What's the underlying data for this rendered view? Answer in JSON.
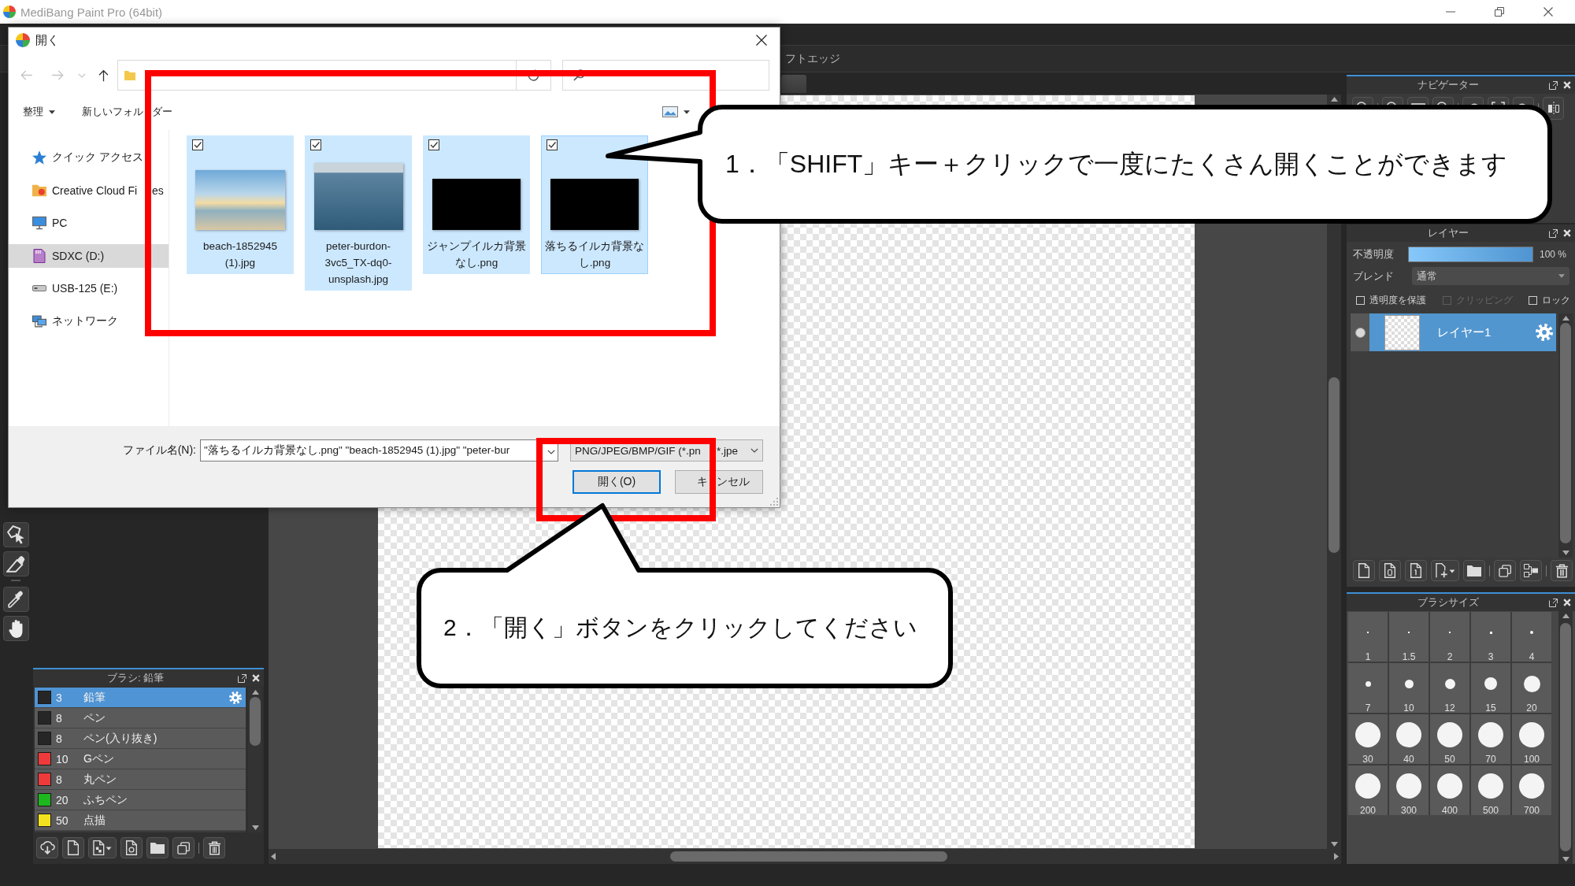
{
  "window": {
    "title": "MediBang Paint Pro (64bit)"
  },
  "tool_options": {
    "label": "フトエッジ"
  },
  "brush_panel": {
    "title": "ブラシ: 鉛筆",
    "brushes": [
      {
        "size": "3",
        "name": "鉛筆",
        "color": "#262626",
        "selected": true
      },
      {
        "size": "8",
        "name": "ペン",
        "color": "#262626",
        "selected": false
      },
      {
        "size": "8",
        "name": "ペン(入り抜き)",
        "color": "#262626",
        "selected": false
      },
      {
        "size": "10",
        "name": "Gペン",
        "color": "#ee3a3a",
        "selected": false
      },
      {
        "size": "8",
        "name": "丸ペン",
        "color": "#ee3a3a",
        "selected": false
      },
      {
        "size": "20",
        "name": "ふちペン",
        "color": "#1db81d",
        "selected": false
      },
      {
        "size": "50",
        "name": "点描",
        "color": "#f2e21e",
        "selected": false
      }
    ]
  },
  "navigator_panel": {
    "title": "ナビゲーター"
  },
  "layer_panel": {
    "title": "レイヤー",
    "opacity": {
      "label": "不透明度",
      "level": 1,
      "reading": "100 %"
    },
    "blend": {
      "label": "ブレンド",
      "value": "通常"
    },
    "options": [
      {
        "label": "透明度を保護",
        "checked": false,
        "disabled": false
      },
      {
        "label": "クリッピング",
        "checked": false,
        "disabled": true
      },
      {
        "label": "ロック",
        "checked": false,
        "disabled": false
      }
    ],
    "layers": [
      {
        "name": "レイヤー1",
        "selected": true,
        "visible": true
      }
    ]
  },
  "brush_size_panel": {
    "title": "ブラシサイズ",
    "sizes": [
      "1",
      "1.5",
      "2",
      "3",
      "4",
      "7",
      "10",
      "12",
      "15",
      "20",
      "30",
      "40",
      "50",
      "70",
      "100",
      "200",
      "300",
      "400",
      "500",
      "700"
    ]
  },
  "dialog": {
    "title": "開く",
    "nav": [
      {
        "kind": "back",
        "disabled": true
      },
      {
        "kind": "forward",
        "disabled": true
      },
      {
        "kind": "recent",
        "disabled": true
      },
      {
        "kind": "up",
        "disabled": false
      }
    ],
    "commands": [
      {
        "label": "整理",
        "kind": "menu"
      },
      {
        "label": "新しいフォル",
        "label_rest": "ダー",
        "kind": "plain"
      }
    ],
    "sidebar": [
      {
        "label": "クイック アクセス",
        "kind": "quick-access",
        "selected": false
      },
      {
        "label": "Creative Cloud Fi",
        "label_rest": "es",
        "kind": "cloud-folder",
        "selected": false
      },
      {
        "label": "PC",
        "kind": "pc",
        "selected": false
      },
      {
        "label": "SDXC (D:)",
        "kind": "sd-card",
        "selected": true
      },
      {
        "label": "USB-125 (E:)",
        "kind": "usb-drive",
        "selected": false
      },
      {
        "label": "ネットワーク",
        "kind": "network",
        "selected": false
      }
    ],
    "files": [
      {
        "name": "beach-1852945 (1).jpg",
        "checked": true,
        "selected": true,
        "focused": false
      },
      {
        "name": "peter-burdon-3vc5_TX-dq0-unsplash.jpg",
        "checked": true,
        "selected": true,
        "focused": false
      },
      {
        "name": "ジャンプイルカ背景なし.png",
        "checked": true,
        "selected": true,
        "focused": false
      },
      {
        "name": "落ちるイルカ背景なし.png",
        "checked": true,
        "selected": true,
        "focused": true
      }
    ],
    "filename": {
      "label": "ファイル名(N):",
      "value": "\"落ちるイルカ背景なし.png\" \"beach-1852945 (1).jpg\" \"peter-bur"
    },
    "filetype": {
      "value": "PNG/JPEG/BMP/GIF (*.pn",
      "value_rest": "*.jpe"
    },
    "buttons": [
      {
        "label": "開く(O)",
        "default": true
      },
      {
        "label": "キ",
        "label_rest": "ンセル",
        "default": false
      }
    ]
  },
  "callouts": [
    {
      "text": "1．「SHIFT」キー＋クリックで一度にたくさん開くことができます"
    },
    {
      "text": "2．「開く」ボタンをクリックしてください"
    }
  ]
}
